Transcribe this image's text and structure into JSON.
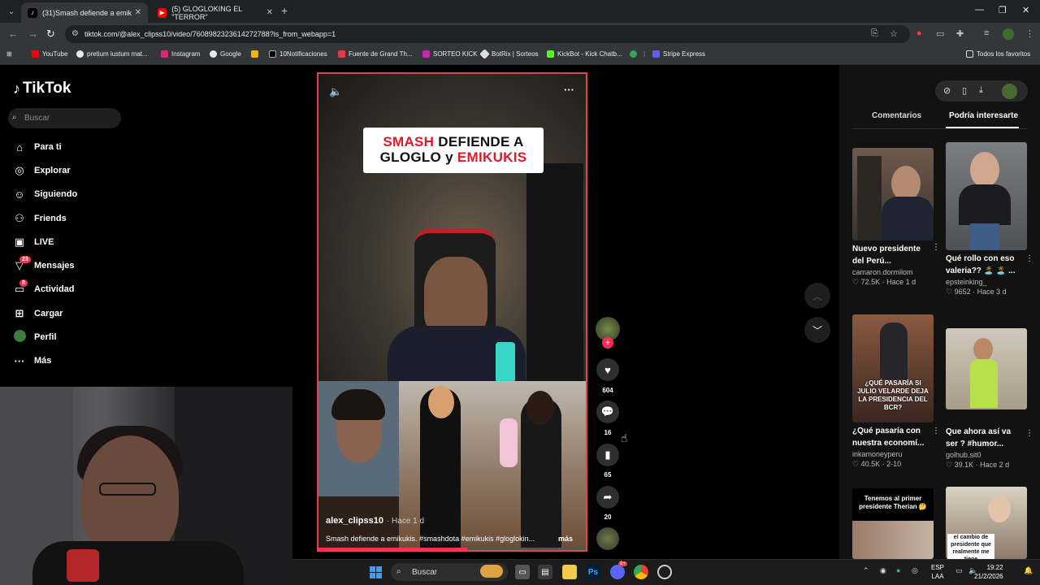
{
  "browser": {
    "tabs": [
      {
        "title": "(31)Smash defiende a emik",
        "active": true
      },
      {
        "title": "(5) GLOGLOKING EL \"TERROR\"",
        "active": false
      }
    ],
    "url": "tiktok.com/@alex_clipss10/video/7608982323614272788?is_from_webapp=1",
    "bookmarks": [
      "YouTube",
      "pretium iustum mat...",
      "Instagram",
      "Google",
      "",
      "10Notificaciones",
      "Fuente de Grand Th...",
      "SORTEO KICK",
      "BotRix | Sorteos",
      "KickBot - Kick Chatb...",
      "",
      "Stripe Express"
    ],
    "all_favorites": "Todos los favoritos"
  },
  "tiktok": {
    "logo": "TikTok",
    "search_placeholder": "Buscar",
    "nav": [
      {
        "label": "Para ti",
        "icon": "home-icon"
      },
      {
        "label": "Explorar",
        "icon": "compass-icon"
      },
      {
        "label": "Siguiendo",
        "icon": "following-icon"
      },
      {
        "label": "Friends",
        "icon": "friends-icon"
      },
      {
        "label": "LIVE",
        "icon": "live-icon"
      },
      {
        "label": "Mensajes",
        "icon": "messages-icon",
        "badge": "23"
      },
      {
        "label": "Actividad",
        "icon": "activity-icon",
        "badge": "8"
      },
      {
        "label": "Cargar",
        "icon": "upload-icon"
      },
      {
        "label": "Perfil",
        "icon": "profile-avatar"
      },
      {
        "label": "Más",
        "icon": "more-icon"
      }
    ]
  },
  "video": {
    "banner_line1_red": "SMASH",
    "banner_line1_rest": " DEFIENDE A",
    "banner_line2_start": "GLOGLO y ",
    "banner_line2_red": "EMIKUKIS",
    "username": "alex_clipss10",
    "posted": "· Hace 1 d",
    "description": "Smash defiende a emikukis. #smashdota #emikukis #gloglokin...",
    "more": "más",
    "likes": "604",
    "comments": "16",
    "saves": "65",
    "shares": "20"
  },
  "panel": {
    "tab_comments": "Comentarios",
    "tab_suggested": "Podría interesarte",
    "cards": [
      {
        "title1": "Nuevo presidente",
        "title2": "del Perú...",
        "user": "camaron.dormilom",
        "stats": "♡ 72.5K · Hace 1 d",
        "caption": ""
      },
      {
        "title1": "Qué rollo con eso",
        "title2": "valeria?? 🏝️ 🏝️ ...",
        "user": "epsteinking_",
        "stats": "♡ 9652 · Hace 3 d",
        "caption": ""
      },
      {
        "title1": "¿Qué pasaría con",
        "title2": "nuestra economí...",
        "user": "inkamoneyperu",
        "stats": "♡ 40.5K · 2-10",
        "caption": "¿QUÉ PASARÍA SI JULIO VELARDE DEJA LA PRESIDENCIA DEL BCR?"
      },
      {
        "title1": "Que ahora así va",
        "title2": "ser ? #humor...",
        "user": "golhub.sit0",
        "stats": "♡ 39.1K · Hace 2 d",
        "caption": ""
      },
      {
        "title1": "",
        "title2": "",
        "user": "",
        "stats": "",
        "caption": "Tenemos al primer presidente Therian 🤔"
      },
      {
        "title1": "",
        "title2": "",
        "user": "",
        "stats": "",
        "caption": "el cambio de presidente que realmente me tiene"
      }
    ]
  },
  "taskbar": {
    "search": "Buscar",
    "lang1": "ESP",
    "lang2": "LAA",
    "time": "19:22",
    "date": "21/2/2026",
    "discord_badge": "9+"
  },
  "colors": {
    "accent": "#fe2c55",
    "border": "#e0444e"
  }
}
